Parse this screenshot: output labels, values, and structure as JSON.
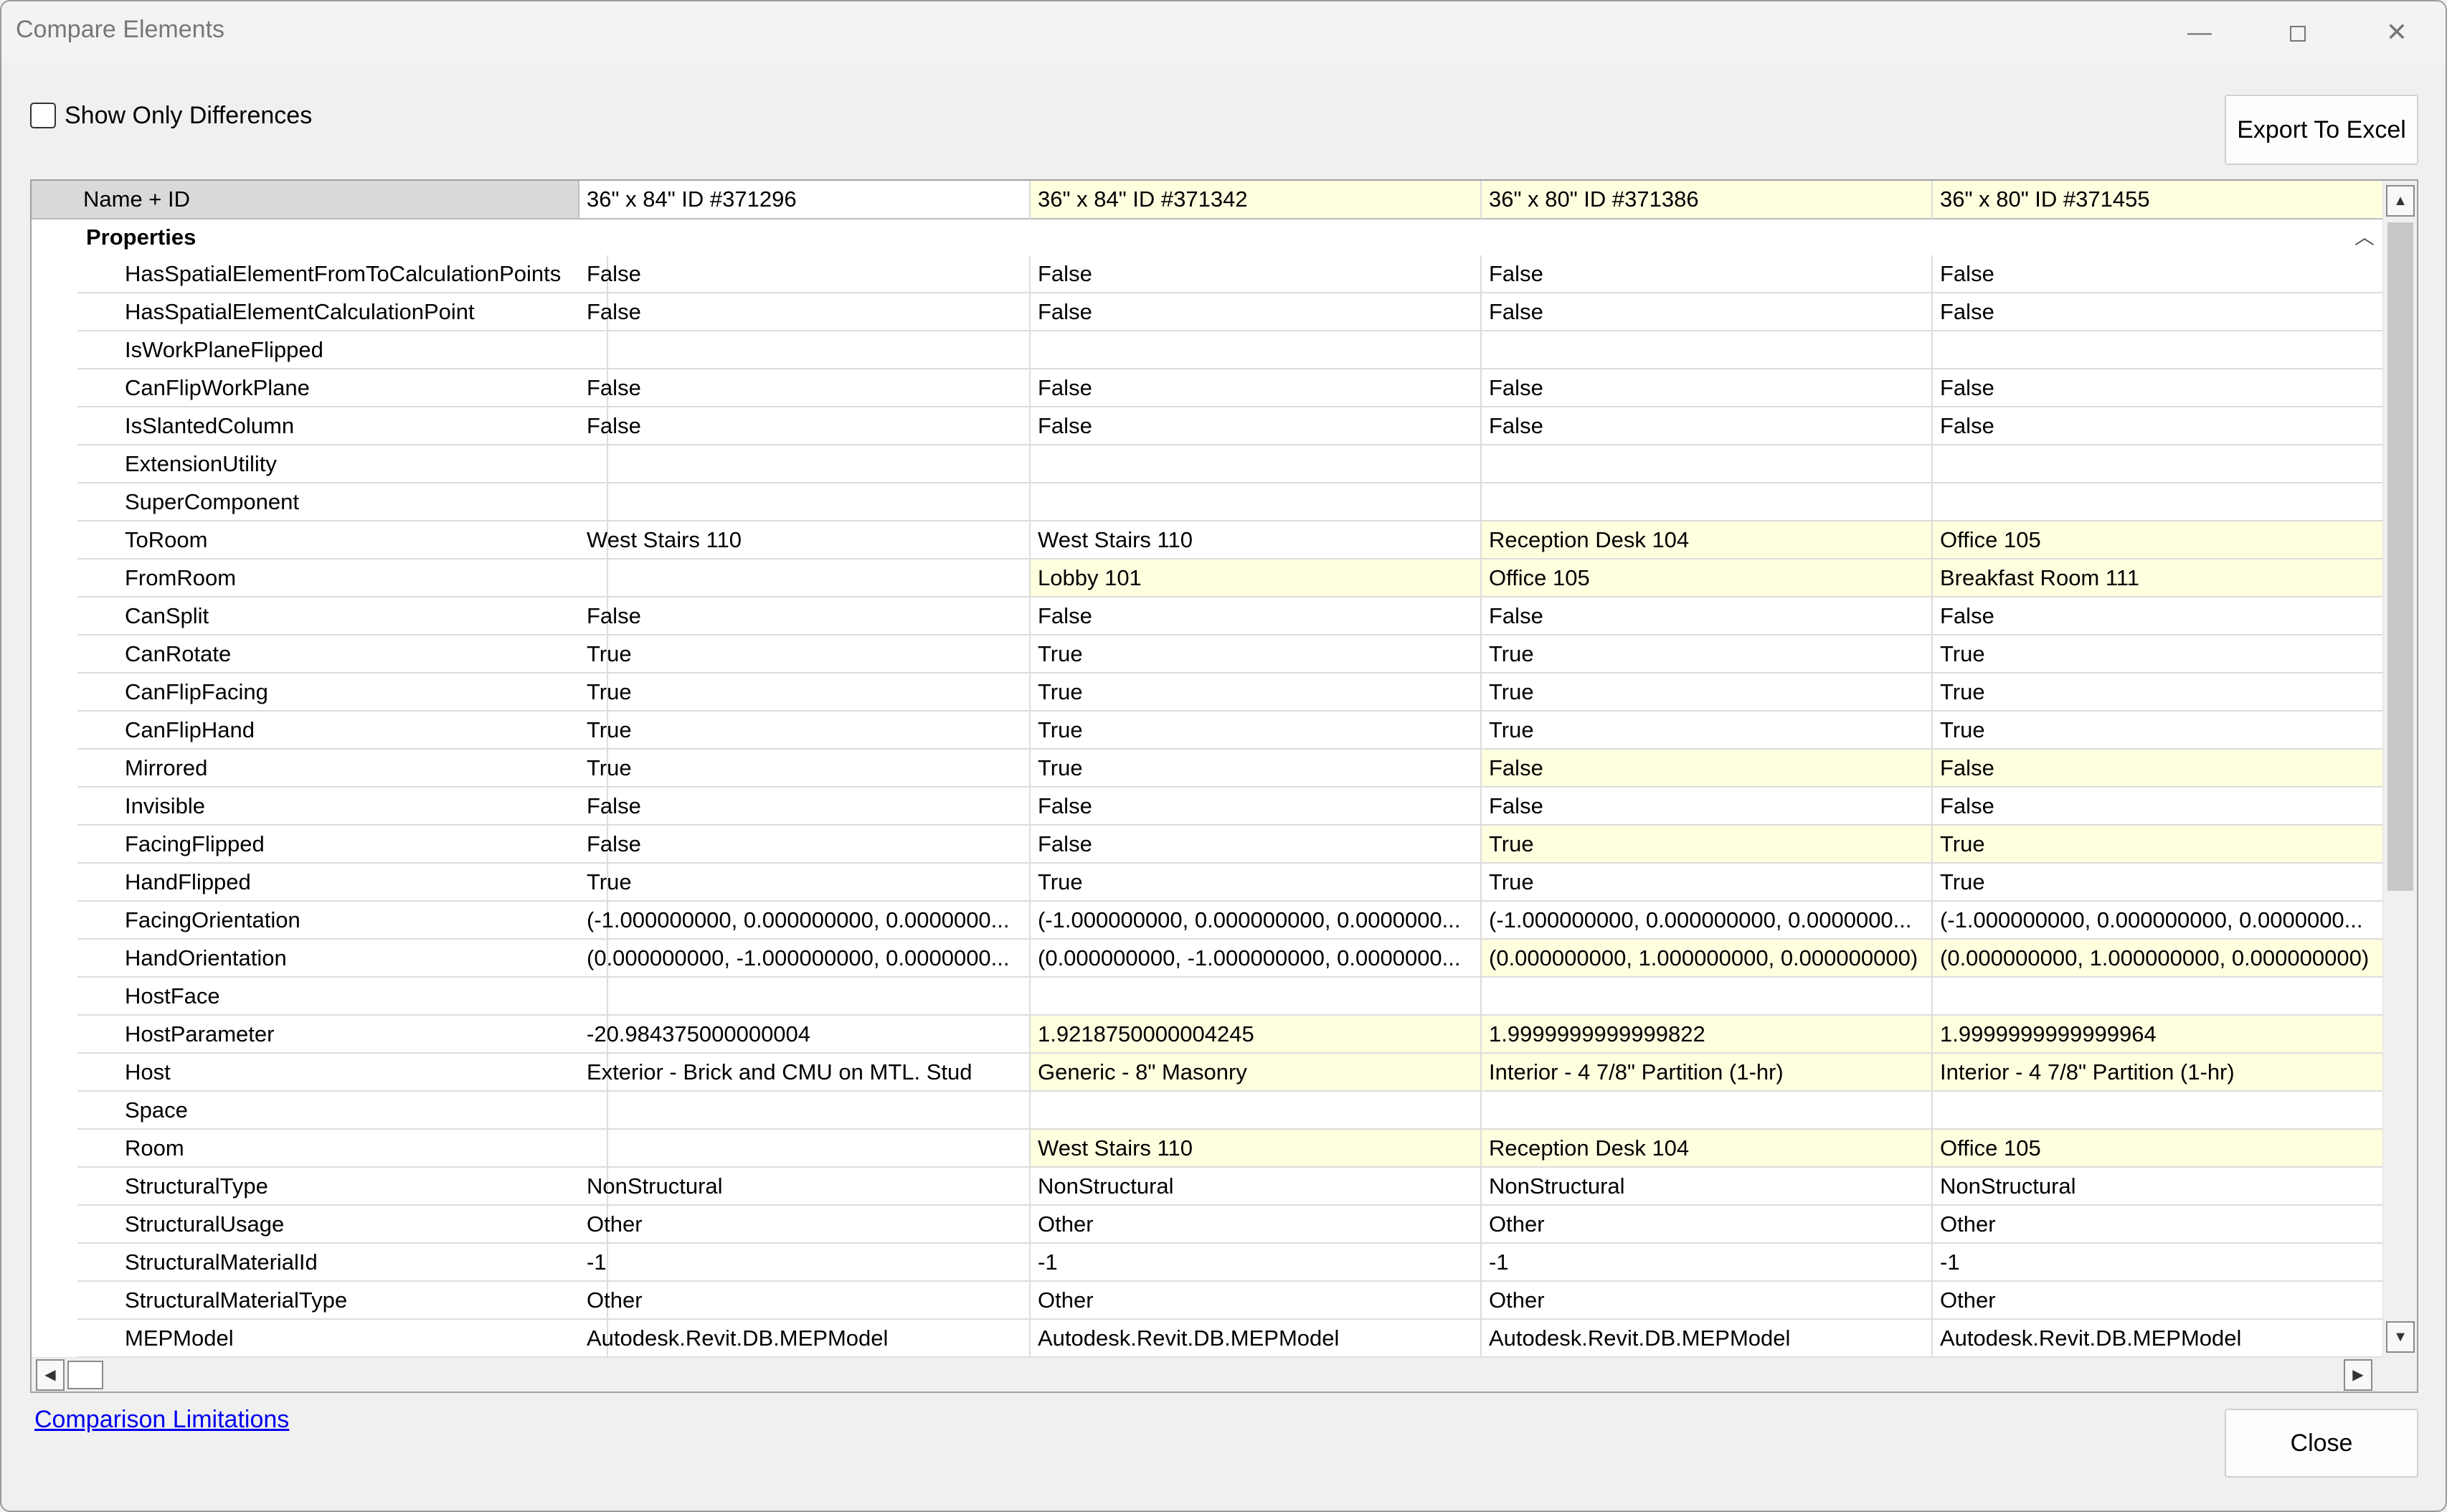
{
  "window": {
    "title": "Compare Elements",
    "minimize_glyph": "—",
    "close_glyph": "✕"
  },
  "options": {
    "show_only_differences_label": "Show Only Differences",
    "show_only_differences_checked": false
  },
  "buttons": {
    "export": "Export To Excel",
    "close": "Close"
  },
  "link": "Comparison Limitations",
  "grid": {
    "header_label": "Name + ID",
    "columns": [
      "36\" x 84\" ID #371296",
      "36\" x 84\" ID #371342",
      "36\" x 80\" ID #371386",
      "36\" x 80\" ID #371455"
    ],
    "group_label": "Properties",
    "collapse_glyph": "︿",
    "rows": [
      {
        "name": "HasSpatialElementFromToCalculationPoints",
        "values": [
          "False",
          "False",
          "False",
          "False"
        ],
        "diff": false
      },
      {
        "name": "HasSpatialElementCalculationPoint",
        "values": [
          "False",
          "False",
          "False",
          "False"
        ],
        "diff": false
      },
      {
        "name": "IsWorkPlaneFlipped",
        "values": [
          "",
          "",
          "",
          ""
        ],
        "diff": false
      },
      {
        "name": "CanFlipWorkPlane",
        "values": [
          "False",
          "False",
          "False",
          "False"
        ],
        "diff": false
      },
      {
        "name": "IsSlantedColumn",
        "values": [
          "False",
          "False",
          "False",
          "False"
        ],
        "diff": false
      },
      {
        "name": "ExtensionUtility",
        "values": [
          "",
          "",
          "",
          ""
        ],
        "diff": false
      },
      {
        "name": "SuperComponent",
        "values": [
          "",
          "",
          "",
          ""
        ],
        "diff": false
      },
      {
        "name": "ToRoom",
        "values": [
          "West Stairs 110",
          "West Stairs 110",
          "Reception Desk 104",
          "Office 105"
        ],
        "diff": true
      },
      {
        "name": "FromRoom",
        "values": [
          "",
          "Lobby 101",
          "Office 105",
          "Breakfast Room 111"
        ],
        "diff": true
      },
      {
        "name": "CanSplit",
        "values": [
          "False",
          "False",
          "False",
          "False"
        ],
        "diff": false
      },
      {
        "name": "CanRotate",
        "values": [
          "True",
          "True",
          "True",
          "True"
        ],
        "diff": false
      },
      {
        "name": "CanFlipFacing",
        "values": [
          "True",
          "True",
          "True",
          "True"
        ],
        "diff": false
      },
      {
        "name": "CanFlipHand",
        "values": [
          "True",
          "True",
          "True",
          "True"
        ],
        "diff": false
      },
      {
        "name": "Mirrored",
        "values": [
          "True",
          "True",
          "False",
          "False"
        ],
        "diff": true
      },
      {
        "name": "Invisible",
        "values": [
          "False",
          "False",
          "False",
          "False"
        ],
        "diff": false
      },
      {
        "name": "FacingFlipped",
        "values": [
          "False",
          "False",
          "True",
          "True"
        ],
        "diff": true
      },
      {
        "name": "HandFlipped",
        "values": [
          "True",
          "True",
          "True",
          "True"
        ],
        "diff": false
      },
      {
        "name": "FacingOrientation",
        "values": [
          "(-1.000000000, 0.000000000, 0.0000000...",
          "(-1.000000000, 0.000000000, 0.0000000...",
          "(-1.000000000, 0.000000000, 0.0000000...",
          "(-1.000000000, 0.000000000, 0.0000000..."
        ],
        "diff": false
      },
      {
        "name": "HandOrientation",
        "values": [
          "(0.000000000, -1.000000000, 0.0000000...",
          "(0.000000000, -1.000000000, 0.0000000...",
          "(0.000000000, 1.000000000, 0.000000000)",
          "(0.000000000, 1.000000000, 0.000000000)"
        ],
        "diff": true
      },
      {
        "name": "HostFace",
        "values": [
          "",
          "",
          "",
          ""
        ],
        "diff": false
      },
      {
        "name": "HostParameter",
        "values": [
          "-20.984375000000004",
          "1.9218750000004245",
          "1.9999999999999822",
          "1.9999999999999964"
        ],
        "diff": true
      },
      {
        "name": "Host",
        "values": [
          "Exterior - Brick and CMU on MTL. Stud",
          "Generic - 8\" Masonry",
          "Interior - 4 7/8\" Partition (1-hr)",
          "Interior - 4 7/8\" Partition (1-hr)"
        ],
        "diff": true
      },
      {
        "name": "Space",
        "values": [
          "",
          "",
          "",
          ""
        ],
        "diff": false
      },
      {
        "name": "Room",
        "values": [
          "",
          "West Stairs 110",
          "Reception Desk 104",
          "Office 105"
        ],
        "diff": true
      },
      {
        "name": "StructuralType",
        "values": [
          "NonStructural",
          "NonStructural",
          "NonStructural",
          "NonStructural"
        ],
        "diff": false
      },
      {
        "name": "StructuralUsage",
        "values": [
          "Other",
          "Other",
          "Other",
          "Other"
        ],
        "diff": false
      },
      {
        "name": "StructuralMaterialId",
        "values": [
          "-1",
          "-1",
          "-1",
          "-1"
        ],
        "diff": false
      },
      {
        "name": "StructuralMaterialType",
        "values": [
          "Other",
          "Other",
          "Other",
          "Other"
        ],
        "diff": false
      },
      {
        "name": "MEPModel",
        "values": [
          "Autodesk.Revit.DB.MEPModel",
          "Autodesk.Revit.DB.MEPModel",
          "Autodesk.Revit.DB.MEPModel",
          "Autodesk.Revit.DB.MEPModel"
        ],
        "diff": false
      }
    ]
  },
  "scroll": {
    "up_glyph": "▲",
    "down_glyph": "▼",
    "left_glyph": "◀",
    "right_glyph": "▶"
  },
  "colors": {
    "difference_highlight": "#ffffe0",
    "header_bg": "#d9d9d9",
    "link": "#0000ee"
  }
}
